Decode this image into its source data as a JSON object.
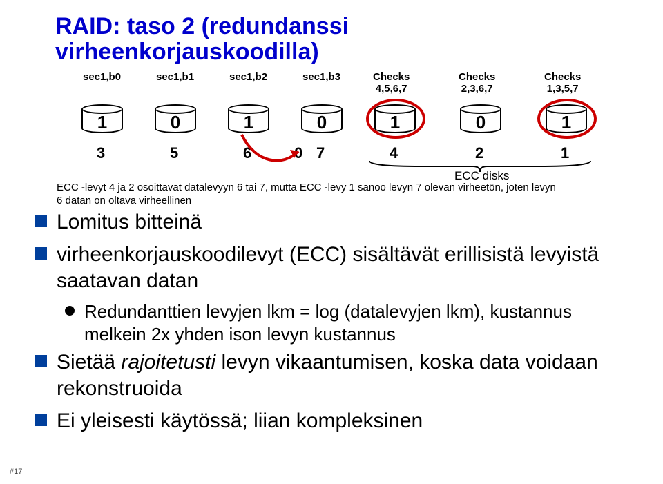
{
  "title_l1": "RAID: taso 2 (redundanssi",
  "title_l2": "virheenkorjauskoodilla)",
  "cols": [
    "sec1,b0",
    "sec1,b1",
    "sec1,b2",
    "sec1,b3"
  ],
  "ecc_cols": [
    {
      "l1": "Checks",
      "l2": "4,5,6,7"
    },
    {
      "l1": "Checks",
      "l2": "2,3,6,7"
    },
    {
      "l1": "Checks",
      "l2": "1,3,5,7"
    }
  ],
  "disk_vals": [
    "1",
    "0",
    "1",
    "0",
    "1",
    "0",
    "1"
  ],
  "nums": [
    "3",
    "5",
    "6",
    "0",
    "7",
    "4",
    "2",
    "1"
  ],
  "ecc_caption": "ECC disks",
  "explain_l1": "ECC -levyt 4 ja 2 osoittavat datalevyyn 6 tai 7, mutta ECC -levy 1 sanoo levyn 7 olevan virheetön, joten levyn",
  "explain_l2": "6 datan on oltava virheellinen",
  "bul1": "Lomitus bitteinä",
  "bul2a": "virheenkorjauskoodilevyt (ECC) sisältävät erillisistä levyistä saatavan datan",
  "bul2b1": "Redundanttien levyjen lkm = log (datalevyjen lkm), kustannus melkein 2x yhden ison levyn kustannus",
  "bul3a": "Sietää ",
  "bul3b": "rajoitetusti",
  "bul3c": " levyn vikaantumisen, koska data voidaan rekonstruoida",
  "bul4": "Ei yleisesti käytössä; liian kompleksinen",
  "slide_num": "#17"
}
